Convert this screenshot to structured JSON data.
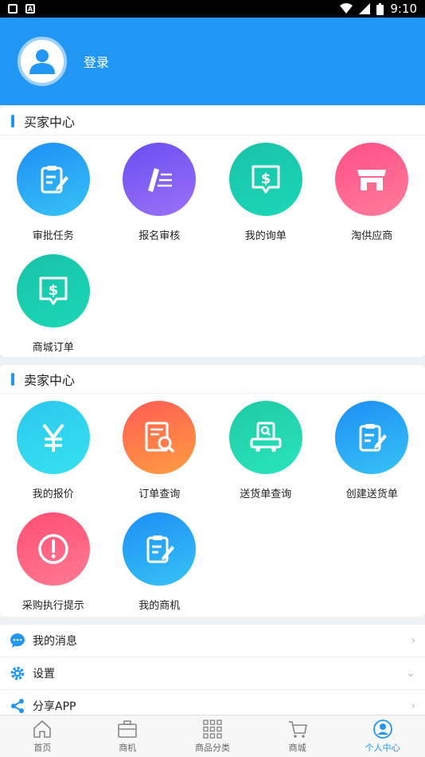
{
  "status_bar": {
    "time": "9:10"
  },
  "header": {
    "login_label": "登录"
  },
  "buyer": {
    "title": "买家中心",
    "items": [
      {
        "label": "审批任务",
        "icon": "clipboard-edit-icon",
        "color": "blue"
      },
      {
        "label": "报名审核",
        "icon": "pen-list-icon",
        "color": "purple"
      },
      {
        "label": "我的询单",
        "icon": "dollar-message-icon",
        "color": "teal"
      },
      {
        "label": "淘供应商",
        "icon": "shop-icon",
        "color": "pink"
      },
      {
        "label": "商城订单",
        "icon": "dollar-message-icon",
        "color": "teal"
      }
    ]
  },
  "seller": {
    "title": "卖家中心",
    "items": [
      {
        "label": "我的报价",
        "icon": "yen-icon",
        "color": "cyan"
      },
      {
        "label": "订单查询",
        "icon": "document-search-icon",
        "color": "orange"
      },
      {
        "label": "送货单查询",
        "icon": "truck-search-icon",
        "color": "green"
      },
      {
        "label": "创建送货单",
        "icon": "clipboard-edit-icon",
        "color": "blue"
      },
      {
        "label": "采购执行提示",
        "icon": "alert-icon",
        "color": "red"
      },
      {
        "label": "我的商机",
        "icon": "clipboard-edit-icon",
        "color": "blue"
      }
    ]
  },
  "menu": {
    "messages": "我的消息",
    "settings": "设置",
    "share": "分享APP"
  },
  "tabs": {
    "home": "首页",
    "business": "商机",
    "category": "商品分类",
    "mall": "商城",
    "personal": "个人中心"
  },
  "colors": {
    "primary": "#2196f3"
  }
}
